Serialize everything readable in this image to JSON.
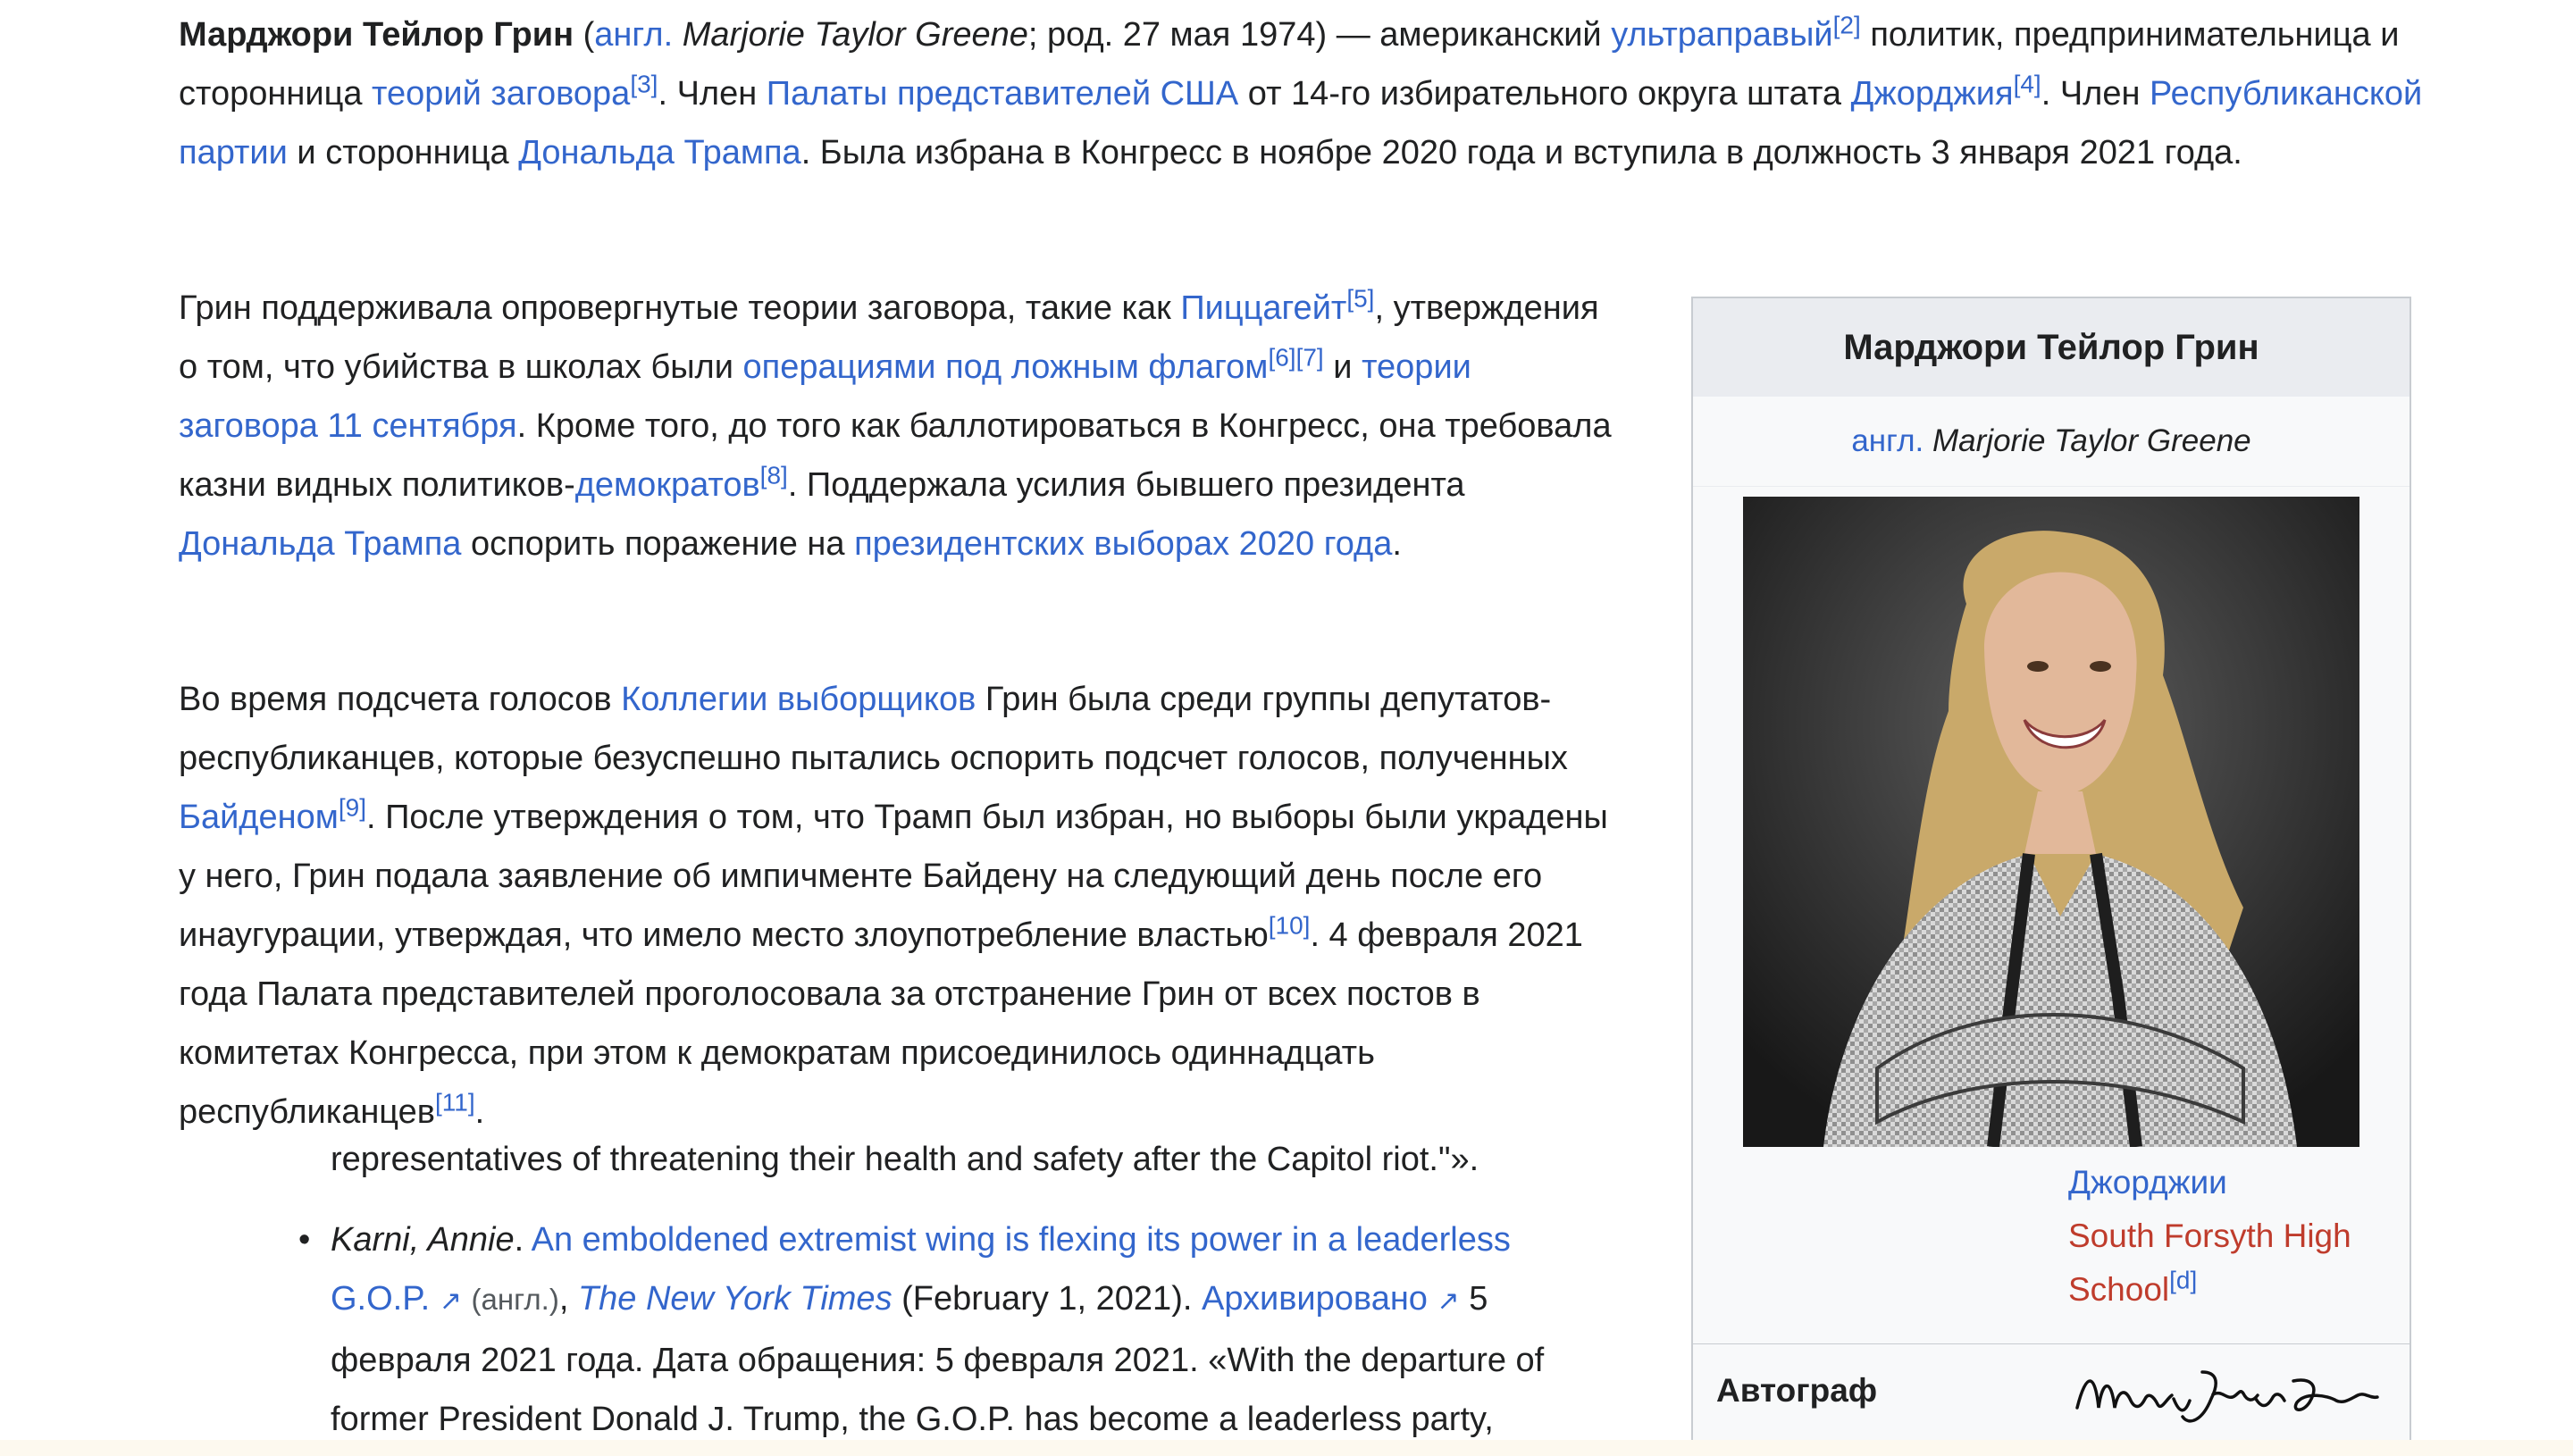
{
  "intro": {
    "name": "Марджори Тейлор Грин",
    "open": " (",
    "lang": "англ.",
    "latin": "Marjorie Taylor Greene",
    "t1": "; род. 27 мая 1974) — американский ",
    "l_ultra": "ультраправый",
    "r2": "[2]",
    "t2": " политик, предпринимательница и сторонница ",
    "l_conspiracy": "теорий заговора",
    "r3": "[3]",
    "t3": ". Член ",
    "l_house": "Палаты представителей США",
    "t4": " от 14-го избирательного округа штата ",
    "l_georgia": "Джорджия",
    "r4": "[4]",
    "t5": ". Член ",
    "l_gop": "Республиканской партии",
    "t6": " и сторонница ",
    "l_trump": "Дональда Трампа",
    "t7": ". Была избрана в Конгресс в ноябре 2020 года и вступила в должность 3 января 2021 года."
  },
  "p2": {
    "t1": "Грин поддерживала опровергнутые теории заговора, такие как ",
    "l_pizza": "Пиццагейт",
    "r5": "[5]",
    "t2": ", утверждения о том, что убийства в школах были ",
    "l_false_flag": "операциями под ложным флагом",
    "r6": "[6]",
    "r7": "[7]",
    "t3": " и ",
    "l_911": "теории заговора 11 сентября",
    "t4": ". Кроме того, до того как баллотироваться в Конгресс, она требовала казни видных политиков-",
    "l_dems": "демократов",
    "r8": "[8]",
    "t5": ". Поддержала усилия бывшего президента ",
    "l_trump": "Дональда Трампа",
    "t6": " оспорить поражение на ",
    "l_elections": "президентских выборах 2020 года",
    "t7": "."
  },
  "p3": {
    "t1": "Во время подсчета голосов ",
    "l_college": "Коллегии выборщиков",
    "t2": " Грин была среди группы депутатов-республиканцев, которые безуспешно пытались оспорить подсчет голосов, полученных ",
    "l_biden": "Байденом",
    "r9": "[9]",
    "t3": ". После утверждения о том, что Трамп был избран, но выборы были украдены у него, Грин подала заявление об импичменте Байдену на следующий день после его инаугурации, утверждая, что имело место злоупотребление властью",
    "r10": "[10]",
    "t4": ". 4 февраля 2021 года Палата представителей проголосовала за отстранение Грин от всех постов в комитетах Конгресса, при этом к демократам присоединилось одиннадцать республиканцев",
    "r11": "[11]",
    "t5": "."
  },
  "refs": {
    "tail": "representatives of threatening their health and safety after the Capitol riot.\"».",
    "author": "Karni, Annie",
    "dot": ". ",
    "article": "An emboldened extremist wing is flexing its power in a leaderless G.O.P.",
    "lang": "(англ.)",
    "comma": ", ",
    "paper": "The New York Times",
    "date": " (February 1, 2021). ",
    "archived": "Архивировано",
    "rest": " 5 февраля 2021 года. Дата обращения: 5 февраля 2021. «With the departure of former President Donald J. Trump, the G.O.P. has become a leaderless party,"
  },
  "infobox": {
    "title": "Марджори Тейлор Грин",
    "lang": "англ.",
    "latin": "Marjorie Taylor Greene",
    "row_georgia": "Джорджии",
    "row_school": "South Forsyth High School",
    "row_school_ref": "[d]",
    "sign_label": "Автограф"
  },
  "colors": {
    "link": "#3366cc",
    "redlink": "#bf3c2c",
    "text": "#202122",
    "infobox_bg": "#f8f9fa",
    "infobox_header": "#eaecf0"
  },
  "icons": {
    "external": "external-link-icon",
    "bullet": "bullet-icon"
  }
}
